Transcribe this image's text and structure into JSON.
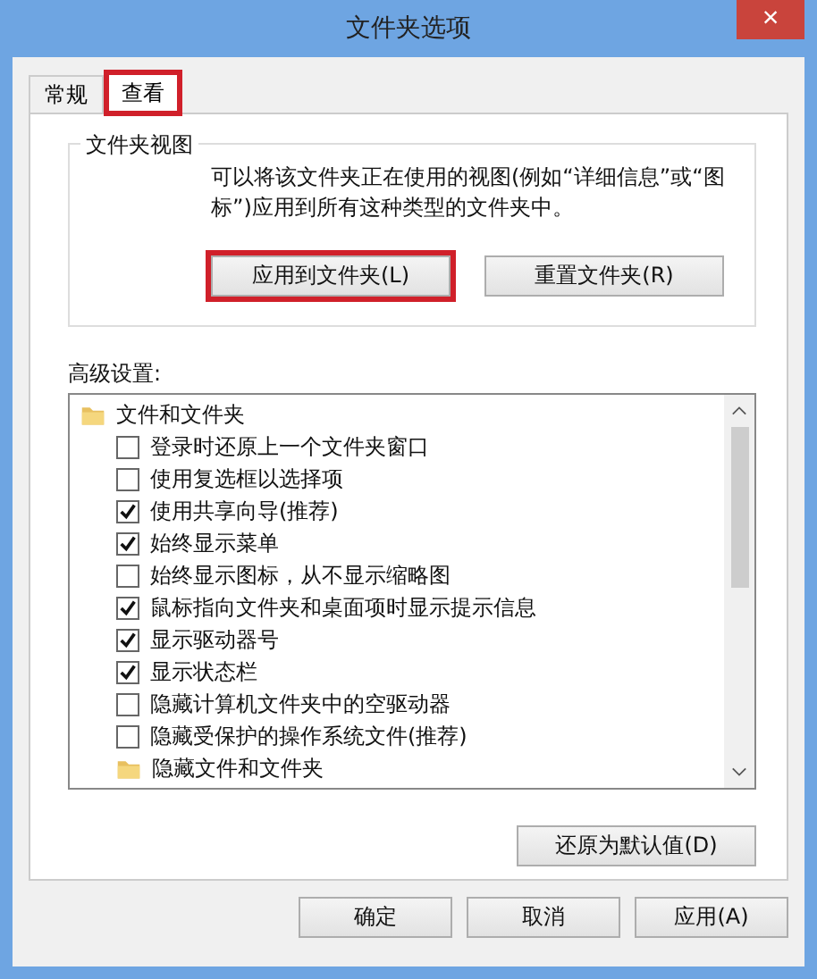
{
  "window": {
    "title": "文件夹选项",
    "close": "×"
  },
  "tabs": [
    {
      "label": "常规",
      "selected": false,
      "highlighted": false
    },
    {
      "label": "查看",
      "selected": true,
      "highlighted": true
    }
  ],
  "folder_views": {
    "title": "文件夹视图",
    "description": "可以将该文件夹正在使用的视图(例如“详细信息”或“图标”)应用到所有这种类型的文件夹中。",
    "buttons": [
      {
        "label": "应用到文件夹(L)",
        "highlighted": true
      },
      {
        "label": "重置文件夹(R)",
        "highlighted": false
      }
    ]
  },
  "advanced": {
    "label": "高级设置:",
    "tree": [
      {
        "kind": "folder",
        "label": "文件和文件夹",
        "children": [
          {
            "kind": "checkbox",
            "label": "登录时还原上一个文件夹窗口",
            "checked": false
          },
          {
            "kind": "checkbox",
            "label": "使用复选框以选择项",
            "checked": false
          },
          {
            "kind": "checkbox",
            "label": "使用共享向导(推荐)",
            "checked": true
          },
          {
            "kind": "checkbox",
            "label": "始终显示菜单",
            "checked": true
          },
          {
            "kind": "checkbox",
            "label": "始终显示图标，从不显示缩略图",
            "checked": false
          },
          {
            "kind": "checkbox",
            "label": "鼠标指向文件夹和桌面项时显示提示信息",
            "checked": true
          },
          {
            "kind": "checkbox",
            "label": "显示驱动器号",
            "checked": true
          },
          {
            "kind": "checkbox",
            "label": "显示状态栏",
            "checked": true
          },
          {
            "kind": "checkbox",
            "label": "隐藏计算机文件夹中的空驱动器",
            "checked": false
          },
          {
            "kind": "checkbox",
            "label": "隐藏受保护的操作系统文件(推荐)",
            "checked": false
          },
          {
            "kind": "folder",
            "label": "隐藏文件和文件夹"
          }
        ]
      }
    ],
    "restore_button": "还原为默认值(D)"
  },
  "buttons": [
    "确定",
    "取消",
    "应用(A)"
  ]
}
